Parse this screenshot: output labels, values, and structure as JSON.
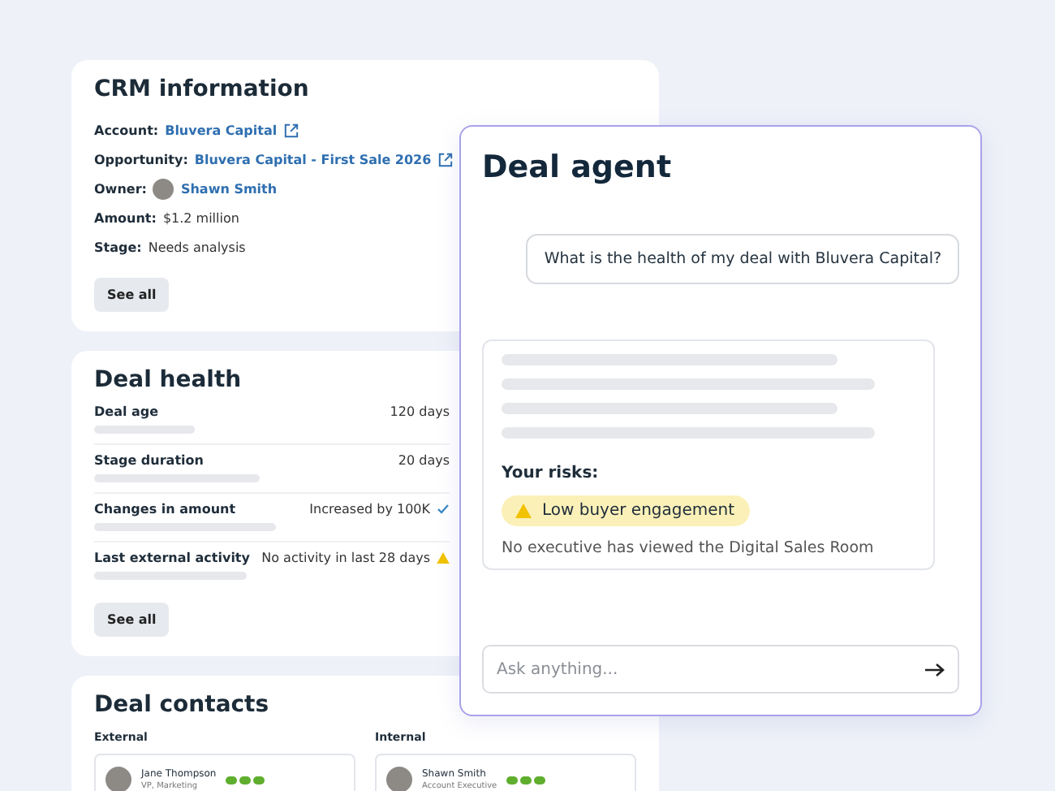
{
  "crm": {
    "title": "CRM information",
    "fields": [
      {
        "kind": "link",
        "label": "Account:",
        "value": "Bluvera Capital",
        "external": true
      },
      {
        "kind": "link",
        "label": "Opportunity:",
        "value": "Bluvera Capital - First Sale 2026",
        "external": true
      },
      {
        "kind": "person",
        "label": "Owner:",
        "value": "Shawn Smith"
      },
      {
        "kind": "text",
        "label": "Amount:",
        "value": "$1.2 million"
      },
      {
        "kind": "text",
        "label": "Stage:",
        "value": "Needs analysis"
      }
    ],
    "button": "See all"
  },
  "health": {
    "title": "Deal health",
    "rows": [
      {
        "label": "Deal age",
        "value": "120 days",
        "kind": "plain"
      },
      {
        "label": "Stage duration",
        "value": "20 days",
        "kind": "plain"
      },
      {
        "label": "Changes in amount",
        "value": "Increased by 100K",
        "kind": "check"
      },
      {
        "label": "Last external activity",
        "value": "No activity in last 28 days",
        "kind": "warning"
      }
    ],
    "button": "See all"
  },
  "contacts": {
    "title": "Deal contacts",
    "groups": [
      {
        "heading": "External",
        "people": [
          {
            "name": "Jane Thompson",
            "role": "VP, Marketing"
          }
        ]
      },
      {
        "heading": "Internal",
        "people": [
          {
            "name": "Shawn Smith",
            "role": "Account Executive"
          }
        ]
      }
    ]
  },
  "agent": {
    "title": "Deal agent",
    "question": "What is the health of my deal with Bluvera Capital?",
    "risks_heading": "Your risks:",
    "risk": {
      "label": "Low buyer engagement",
      "detail": "No executive has viewed the Digital Sales Room"
    },
    "input": {
      "placeholder": "Ask anything..."
    }
  }
}
